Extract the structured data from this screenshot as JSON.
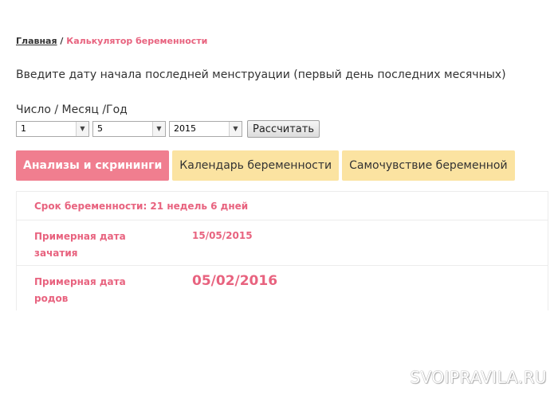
{
  "breadcrumb": {
    "home": "Главная",
    "separator": "/",
    "current": "Калькулятор беременности"
  },
  "form": {
    "instruction": "Введите дату начала последней менструации (первый день последних месячных)",
    "date_label": "Число / Месяц /Год",
    "day_value": "1",
    "month_value": "5",
    "year_value": "2015",
    "calculate_label": "Рассчитать"
  },
  "tabs": [
    {
      "label": "Анализы и скрининги",
      "active": true
    },
    {
      "label": "Календарь беременности",
      "active": false
    },
    {
      "label": "Самочувствие беременной",
      "active": false
    }
  ],
  "result": {
    "term": "Срок беременности: 21 недель 6 дней",
    "conception_label": "Примерная дата зачатия",
    "conception_date": "15/05/2015",
    "birth_label": "Примерная дата родов",
    "birth_date": "05/02/2016"
  },
  "watermark": "SVOIPRAVILA.RU",
  "colors": {
    "accent": "#e8637f",
    "tab_active": "#f07e8f",
    "tab_inactive": "#fbe3a1"
  },
  "icons": {
    "select_arrow": "chevron-down-icon"
  }
}
